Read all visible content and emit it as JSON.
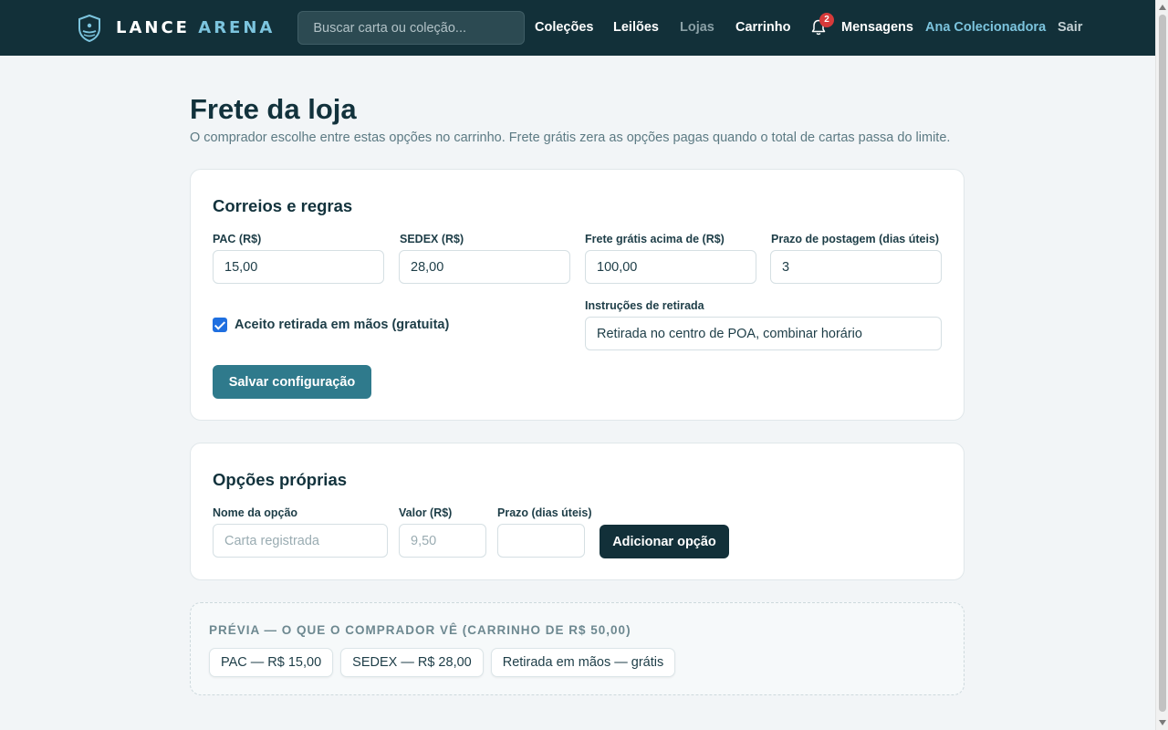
{
  "brand": {
    "name_part1": "LANCE",
    "name_part2": "ARENA"
  },
  "search": {
    "placeholder": "Buscar carta ou coleção..."
  },
  "nav": {
    "colecoes": "Coleções",
    "leiloes": "Leilões",
    "lojas": "Lojas",
    "carrinho": "Carrinho",
    "notifications_count": "2",
    "mensagens": "Mensagens",
    "user": "Ana Colecionadora",
    "sair": "Sair"
  },
  "page": {
    "title": "Frete da loja",
    "subtitle": "O comprador escolhe entre estas opções no carrinho. Frete grátis zera as opções pagas quando o total de cartas passa do limite."
  },
  "correios": {
    "title": "Correios e regras",
    "pac_label": "PAC (R$)",
    "pac_value": "15,00",
    "sedex_label": "SEDEX (R$)",
    "sedex_value": "28,00",
    "free_label": "Frete grátis acima de (R$)",
    "free_value": "100,00",
    "deadline_label": "Prazo de postagem (dias úteis)",
    "deadline_value": "3",
    "pickup_checkbox_label": "Aceito retirada em mãos (gratuita)",
    "pickup_checked": true,
    "pickup_instructions_label": "Instruções de retirada",
    "pickup_instructions_value": "Retirada no centro de POA, combinar horário",
    "save_button": "Salvar configuração"
  },
  "custom_options": {
    "title": "Opções próprias",
    "name_label": "Nome da opção",
    "name_placeholder": "Carta registrada",
    "value_label": "Valor (R$)",
    "value_placeholder": "9,50",
    "deadline_label": "Prazo (dias úteis)",
    "deadline_placeholder": "",
    "add_button": "Adicionar opção"
  },
  "preview": {
    "title": "PRÉVIA — O QUE O COMPRADOR VÊ (CARRINHO DE R$ 50,00)",
    "chips": [
      "PAC — R$ 15,00",
      "SEDEX — R$ 28,00",
      "Retirada em mãos — grátis"
    ]
  },
  "colors": {
    "nav_bg": "#123039",
    "accent": "#7cc4de",
    "save_button": "#2f7a8c",
    "add_button": "#123039",
    "badge": "#d63a3a",
    "checkbox": "#1f6fe0"
  },
  "icons": {
    "brand": "shield-icon",
    "notifications": "bell-icon"
  }
}
